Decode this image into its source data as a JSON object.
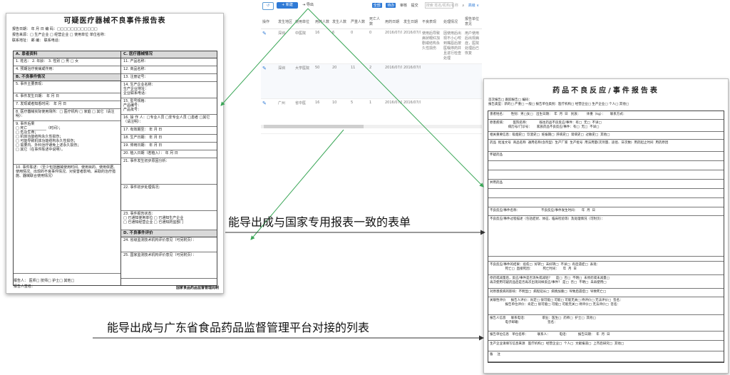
{
  "device_form": {
    "title": "可疑医疗器械不良事件报告表",
    "header_lines": [
      "报告日期：    年  月  日                编  码：□□□□□□□□□□□□",
      "报告来源：□ 生产企业 □ 经营企业 □ 使用单位  单位名称：",
      "联系地址：                              邮  编：        联系电话："
    ],
    "left_sections": [
      {
        "title": "A. 患者资料",
        "rows": [
          "1. 姓名：      2. 年龄：   3. 性别 □ 男 □ 女",
          "4. 预期治疗疾病或作用："
        ]
      },
      {
        "title": "B. 不良事件情况",
        "rows": [
          "5. 事件主要表现：",
          "6. 事件发生日期：      年  月  日",
          "7. 发现或者知悉时间：    年  月  日",
          "8. 医疗器械实际使用场所：□ 医疗机构 □ 家庭 □ 其它（请注明）：",
          "9. 事件后果\n□ 死亡 __________（时间）；\n□ 危及生命；\n□ 机体功能结构永久性损伤；\n□ 可能导致机体功能结构永久性损伤；\n□ 需要内、外科治疗避免上述永久损伤；\n□ 其它（在事件陈述中说明）。",
          "10. 事件陈述：（至少包括器械使用时间、使用目的、使用依据、使用情况、出现的不良事件情况、对受害者影响、采取的治疗措施、器械联合使用情况）"
        ]
      }
    ],
    "right_sections": [
      {
        "title": "C. 医疗器械情况",
        "rows": [
          "11. 产品名称：",
          "12. 商品名称：",
          "13. 注册证号：",
          "14. 生产企业名称：\n生产企业地址：\n企业联系电话：",
          "15. 型号规格：\n产品编号：\n产品批号：",
          "16. 操 作 人：□专业人员 □非专业人员 □患者 □其它（请注明）：",
          "17. 有效期至：      年  月  日",
          "18. 生产日期：      年  月  日",
          "19. 停用日期：      年  月  日",
          "20. 植入日期（若植入）：  年  月  日",
          "21. 事件发生初步原因分析：",
          "22. 事件初步处理情况：",
          "23. 事件报告状态：\n□ 已通知使用单位 □ 已通知生产企业\n□ 已通知经营企业 □ 已通知药监部门"
        ]
      },
      {
        "title": "D. 不良事件评价",
        "rows": [
          "24. 省级监测技术机构评价意见（可另附页）：",
          "25. 国家监测技术机构评价意见（可另附页）："
        ]
      }
    ],
    "footer_lines": [
      "报告人：  医师□   技师□   护士□    其他□",
      "报告人签名："
    ],
    "org": "国家食品药品监督管理局制"
  },
  "list_screen": {
    "refresh_label": "↺",
    "new_label": "+ 新建",
    "export_label": "导出",
    "right_tabs": [
      "全部",
      "待办",
      "审核",
      "提交"
    ],
    "search_placeholder": "搜索 姓名/机构/名称",
    "advanced_label": "高级 ∨",
    "columns": [
      "操作",
      "发生地区",
      "使用单位",
      "用药人数",
      "发生人数",
      "严重人数",
      "死亡人数",
      "用药日期",
      "发生日期",
      "不良表现",
      "处理情况",
      "报告单位意见"
    ],
    "rows": [
      [
        "",
        "深圳",
        "中医院",
        "16",
        "6",
        "0",
        "0",
        "2016/07/01",
        "2016/07/01",
        "使用后导致病状眼红加剧或结构永久性损伤",
        "因使用后出现不小心咬到嘴唇后按医嘱停药并且进行检查处理",
        "用户使用后出现病症，医院处理后已恢复"
      ],
      [
        "",
        "深圳",
        "大学医院",
        "50",
        "20",
        "11",
        "2",
        "2016/07/01",
        "2016/07/01",
        "",
        "",
        ""
      ],
      [
        "",
        "广州",
        "省中医",
        "16",
        "10",
        "5",
        "1",
        "2016/07/01",
        "2016/07/01",
        "",
        "",
        ""
      ]
    ]
  },
  "drug_form": {
    "title": "药品不良反应/事件报告表",
    "header_lines": [
      "首次报告□   跟踪报告□               编码：",
      "报告类型：新的□  严重□  一般□   报告单位类别：医疗机构□  经营企业□  生产企业□  个人□  其他□"
    ],
    "rows": [
      "患者姓名：     性别：男□女□   出生日期：  年  月  日   民族：      体重（kg）：     联系方式：",
      "原患疾病：       医院名称：          既往药品不良反应/事件：有□  无□  不详□\n                  病历号/门诊号：     家族药品不良反应/事件：有□  无□  不详□",
      "相关重要信息：吸烟史□  饮酒史□  妊娠期□  肝病史□  肾病史□  过敏史□  其他□",
      "药品  批准文号  商品名称  通用名称(含剂型)  生产厂家  生产批号  用法用量(次剂量、途径、日次数)  用药起止时间  用药原因",
      "怀疑药品",
      "",
      "",
      "并用药品",
      "",
      "",
      "不良反应/事件名称：                     不良反应/事件发生时间：    年  月  日",
      "不良反应/事件过程描述（包括症状、体征、临床检验等）及处理情况（可附页）：",
      "",
      "不良反应/事件的结果：痊愈□  好转□  未好转□  不详□  有后遗症□  表现：\n               死亡□  直接死因：          死亡时间：    年  月  日",
      "停药或减量后，反应/事件是否消失或减轻？    是□  否□  不明□  未停药或未减量□\n再次使用可疑药品后是否再次出现同样反应/事件？ 是□  否□  不明□  未再使用□",
      "对原患疾病的影响：不明显□  病程延长□  病情加重□  导致后遗症□  导致死亡□",
      "关联性评价     报告人评价：肯定□ 很可能□ 可能□ 可能无关□ 待评价□ 无法评价□  签名：\n               报告单位评价：肯定□ 很可能□ 可能□ 可能无关□ 待评价□ 无法评价□  签名：",
      "报告人信息     联系电话：               职业：医生□  药师□  护士□  其他□\n               电子邮箱：                          签名：",
      "报告单位信息   单位名称：         联系人：         电话：         报告日期：  年  月  日",
      "生产企业请填写信息来源   医疗机构□  经营企业□  个人□  文献报道□  上市后研究□  其他□",
      "备    注"
    ]
  },
  "annotations": {
    "drug_form_caption": "能导出成与国家专用报表一致的表单",
    "platform_caption": "能导出成与广东省食品药品监督管理平台对接的列表"
  },
  "colors": {
    "accent": "#2f7ad6",
    "arrow": "#3aa657",
    "section_bg": "#d9d9d9"
  }
}
